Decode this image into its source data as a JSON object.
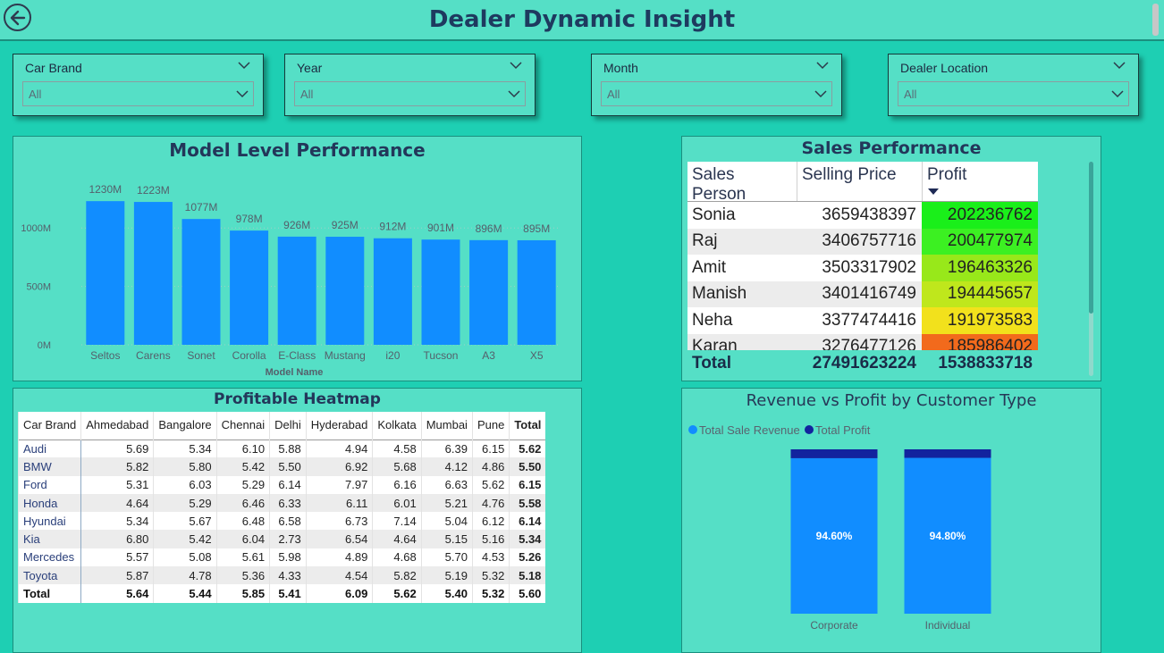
{
  "header": {
    "title": "Dealer Dynamic Insight"
  },
  "slicers": [
    {
      "label": "Car Brand",
      "value": "All"
    },
    {
      "label": "Year",
      "value": "All"
    },
    {
      "label": "Month",
      "value": "All"
    },
    {
      "label": "Dealer Location",
      "value": "All"
    }
  ],
  "model_panel": {
    "title": "Model Level Performance"
  },
  "sales_panel": {
    "title": "Sales Performance",
    "columns": [
      "Sales Person",
      "Selling Price",
      "Profit"
    ],
    "rows": [
      {
        "name": "Sonia",
        "price": "3659438397",
        "profit": "202236762",
        "color": "#1aef1a"
      },
      {
        "name": "Raj",
        "price": "3406757716",
        "profit": "200477974",
        "color": "#3cf022"
      },
      {
        "name": "Amit",
        "price": "3503317902",
        "profit": "196463326",
        "color": "#98e81a"
      },
      {
        "name": "Manish",
        "price": "3401416749",
        "profit": "194445657",
        "color": "#bfe71c"
      },
      {
        "name": "Neha",
        "price": "3377474416",
        "profit": "191973583",
        "color": "#f2e11c"
      },
      {
        "name": "Karan",
        "price": "3276477126",
        "profit": "185986402",
        "color": "#f26a1c"
      }
    ],
    "total": {
      "label": "Total",
      "price": "27491623224",
      "profit": "1538833718"
    }
  },
  "heatmap_panel": {
    "title": "Profitable Heatmap",
    "columns": [
      "Car Brand",
      "Ahmedabad",
      "Bangalore",
      "Chennai",
      "Delhi",
      "Hyderabad",
      "Kolkata",
      "Mumbai",
      "Pune",
      "Total"
    ],
    "rows": [
      [
        "Audi",
        "5.69",
        "5.34",
        "6.10",
        "5.88",
        "4.94",
        "4.58",
        "6.39",
        "6.15",
        "5.62"
      ],
      [
        "BMW",
        "5.82",
        "5.80",
        "5.42",
        "5.50",
        "6.92",
        "5.68",
        "4.12",
        "4.86",
        "5.50"
      ],
      [
        "Ford",
        "5.31",
        "6.03",
        "5.29",
        "6.14",
        "7.97",
        "6.16",
        "6.63",
        "5.62",
        "6.15"
      ],
      [
        "Honda",
        "4.64",
        "5.29",
        "6.46",
        "6.33",
        "6.11",
        "6.01",
        "5.21",
        "4.76",
        "5.58"
      ],
      [
        "Hyundai",
        "5.34",
        "5.67",
        "6.48",
        "6.58",
        "6.73",
        "7.14",
        "5.04",
        "6.12",
        "6.14"
      ],
      [
        "Kia",
        "6.80",
        "5.42",
        "6.04",
        "2.73",
        "6.54",
        "4.64",
        "5.15",
        "5.16",
        "5.34"
      ],
      [
        "Mercedes",
        "5.57",
        "5.08",
        "5.61",
        "5.98",
        "4.89",
        "4.68",
        "5.70",
        "4.53",
        "5.26"
      ],
      [
        "Toyota",
        "5.87",
        "4.78",
        "5.36",
        "4.33",
        "4.54",
        "5.82",
        "5.19",
        "5.32",
        "5.18"
      ]
    ],
    "total_row": [
      "Total",
      "5.64",
      "5.44",
      "5.85",
      "5.41",
      "6.09",
      "5.62",
      "5.40",
      "5.32",
      "5.60"
    ]
  },
  "customer_panel": {
    "title": "Revenue vs Profit by Customer Type"
  },
  "chart_data": [
    {
      "type": "bar",
      "title": "Model Level Performance",
      "xlabel": "Model Name",
      "ylabel": "",
      "categories": [
        "Seltos",
        "Carens",
        "Sonet",
        "Corolla",
        "E-Class",
        "Mustang",
        "i20",
        "Tucson",
        "A3",
        "X5"
      ],
      "values": [
        1230,
        1223,
        1077,
        978,
        926,
        925,
        912,
        901,
        896,
        895
      ],
      "value_labels": [
        "1230M",
        "1223M",
        "1077M",
        "978M",
        "926M",
        "925M",
        "912M",
        "901M",
        "896M",
        "895M"
      ],
      "yticks": [
        "0M",
        "500M",
        "1000M"
      ],
      "ytick_values": [
        0,
        500,
        1000
      ],
      "ylim": [
        0,
        1300
      ],
      "grid": true,
      "color": "#118dff"
    },
    {
      "type": "bar",
      "stacked": true,
      "percent": true,
      "title": "Revenue vs Profit by Customer Type",
      "categories": [
        "Corporate",
        "Individual"
      ],
      "series": [
        {
          "name": "Total Sale Revenue",
          "values": [
            94.6,
            94.8
          ],
          "labels": [
            "94.60%",
            "94.80%"
          ],
          "color": "#118dff"
        },
        {
          "name": "Total Profit",
          "values": [
            5.4,
            5.2
          ],
          "color": "#12239e"
        }
      ],
      "legend": "top-left"
    }
  ]
}
